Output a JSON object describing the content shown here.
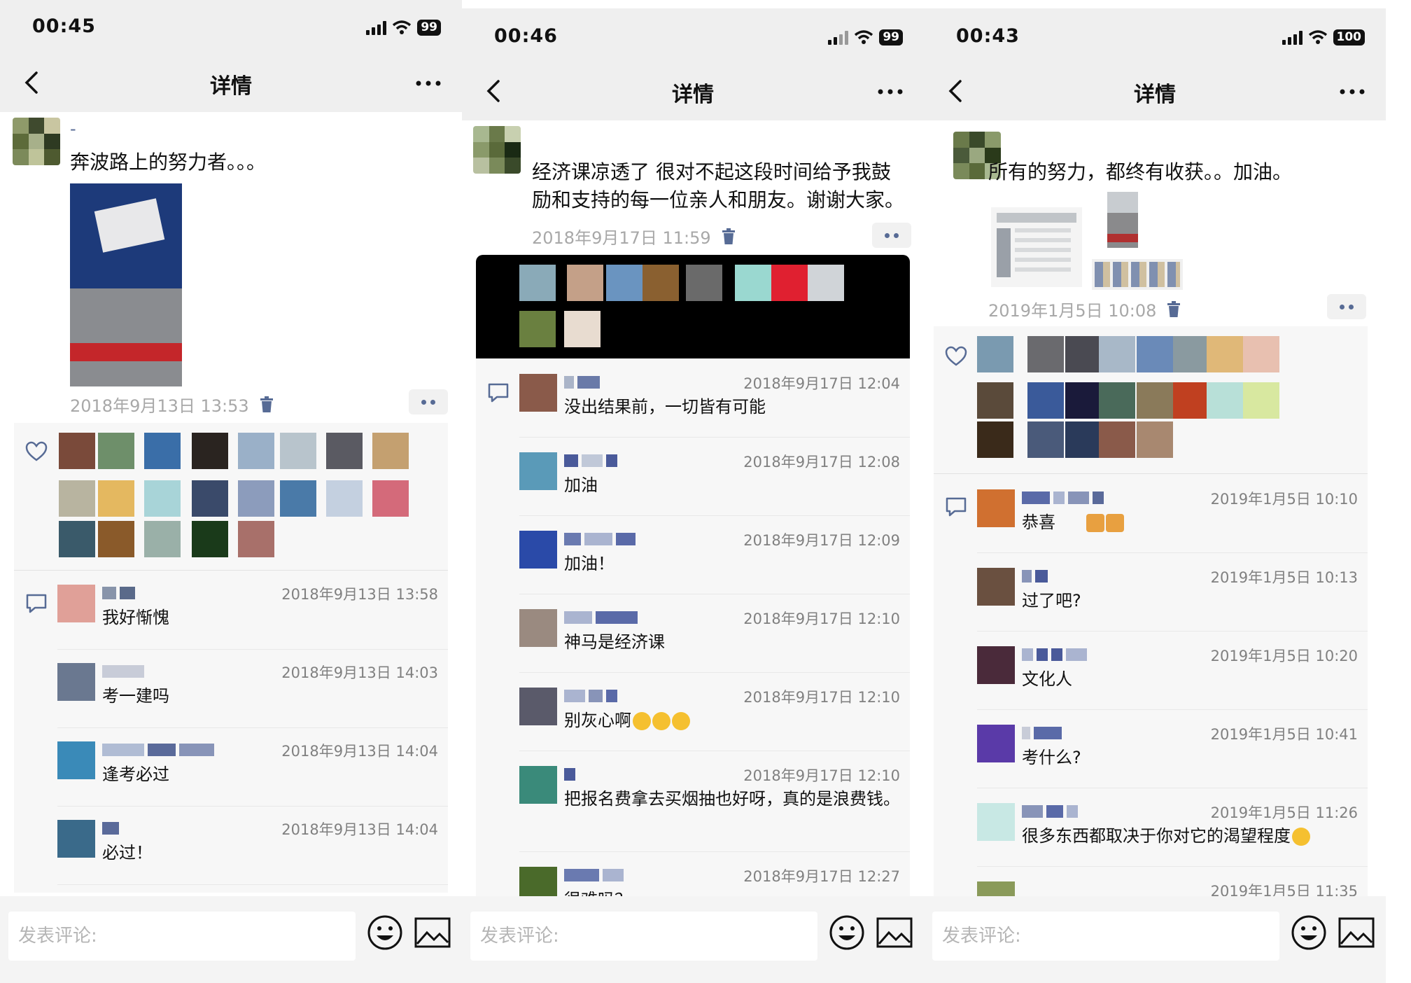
{
  "panels": [
    {
      "status": {
        "time": "00:45",
        "battery": "99"
      },
      "nav": {
        "title": "详情"
      },
      "post": {
        "name": "-",
        "text": "奔波路上的努力者。。。",
        "time": "2018年9月13日 13:53"
      },
      "comments": [
        {
          "time": "2018年9月13日 13:58",
          "text": "我好惭愧"
        },
        {
          "time": "2018年9月13日 14:03",
          "text": "考一建吗"
        },
        {
          "time": "2018年9月13日 14:04",
          "text": "逢考必过"
        },
        {
          "time": "2018年9月13日 14:04",
          "text": "必过！"
        }
      ],
      "input": {
        "placeholder": "发表评论:"
      }
    },
    {
      "status": {
        "time": "00:46",
        "battery": "99"
      },
      "nav": {
        "title": "详情"
      },
      "post": {
        "text_line1": "经济课凉透了 很对不起这段时间给予我鼓",
        "text_line2": "励和支持的每一位亲人和朋友。谢谢大家。",
        "time": "2018年9月17日 11:59"
      },
      "comments": [
        {
          "time": "2018年9月17日 12:04",
          "text": "没出结果前，一切皆有可能"
        },
        {
          "time": "2018年9月17日 12:08",
          "text": "加油"
        },
        {
          "time": "2018年9月17日 12:09",
          "text": "加油！"
        },
        {
          "time": "2018年9月17日 12:10",
          "text": "神马是经济课"
        },
        {
          "time": "2018年9月17日 12:10",
          "text": "别灰心啊"
        },
        {
          "time": "2018年9月17日 12:10",
          "text": "把报名费拿去买烟抽也好呀，真的是浪费钱。"
        },
        {
          "time": "2018年9月17日 12:27",
          "text": "很难吗？"
        }
      ],
      "input": {
        "placeholder": "发表评论:"
      }
    },
    {
      "status": {
        "time": "00:43",
        "battery": "100"
      },
      "nav": {
        "title": "详情"
      },
      "post": {
        "text": "所有的努力，都终有收获。。加油。",
        "time": "2019年1月5日 10:08"
      },
      "comments": [
        {
          "time": "2019年1月5日 10:10",
          "text": "恭喜"
        },
        {
          "time": "2019年1月5日 10:13",
          "text": "过了吧?"
        },
        {
          "time": "2019年1月5日 10:20",
          "text": "文化人"
        },
        {
          "time": "2019年1月5日 10:41",
          "text": "考什么?"
        },
        {
          "time": "2019年1月5日 11:26",
          "text": "很多东西都取决于你对它的渴望程度"
        },
        {
          "time": "2019年1月5日 11:35",
          "text": ""
        }
      ],
      "input": {
        "placeholder": "发表评论:"
      }
    }
  ],
  "icons": {
    "back": "chevron-left-icon",
    "more": "more-dots-icon",
    "delete": "trash-icon",
    "like": "heart-icon",
    "comment": "comment-icon",
    "emoji": "emoji-icon",
    "image": "image-icon"
  },
  "colors": {
    "link_blue": "#576b95",
    "bar_gray": "#efefef",
    "like_area": "#f7f7f7",
    "meta_gray": "#a8a8a8"
  }
}
